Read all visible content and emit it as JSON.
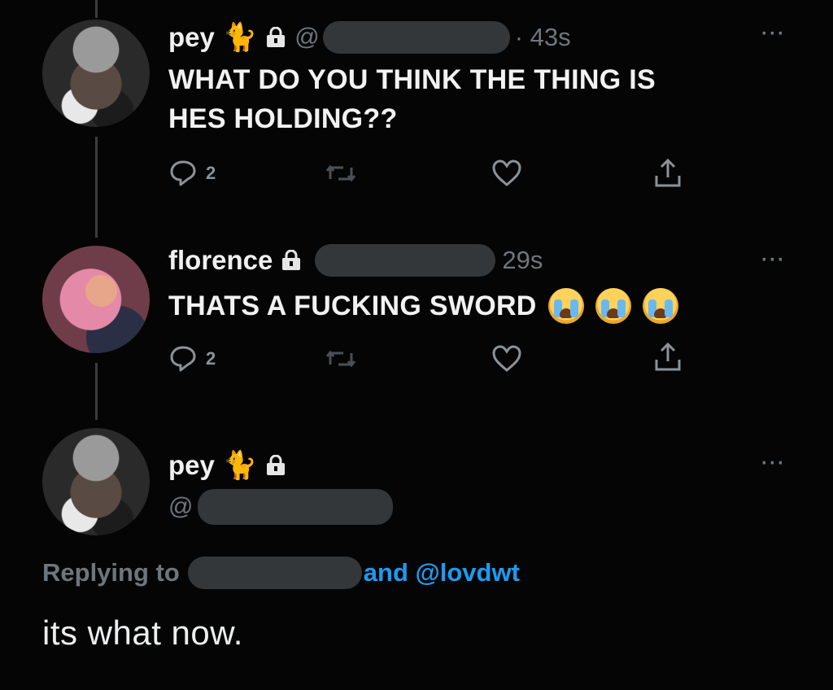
{
  "colors": {
    "background": "#050505",
    "text": "#e7e9ea",
    "muted": "#6e767d",
    "link": "#1d9bf0"
  },
  "tweets": [
    {
      "name": "pey",
      "handle_prefix": "@",
      "time": "43s",
      "text_line1": "WHAT DO YOU THINK THE THING IS",
      "text_line2": "HES HOLDING??",
      "reply_count": "2",
      "icons": [
        "cat-icon",
        "lock-icon",
        "more-icon",
        "reply-icon",
        "retweet-icon",
        "like-icon",
        "share-icon"
      ]
    },
    {
      "name": "florence",
      "time": "29s",
      "text": "THATS A FUCKING SWORD",
      "emoji_count": 3,
      "reply_count": "2"
    }
  ],
  "main_tweet": {
    "name": "pey",
    "handle_prefix": "@",
    "replying_label": "Replying to",
    "replying_suffix": "and @lovdwt",
    "text": "its what now."
  }
}
